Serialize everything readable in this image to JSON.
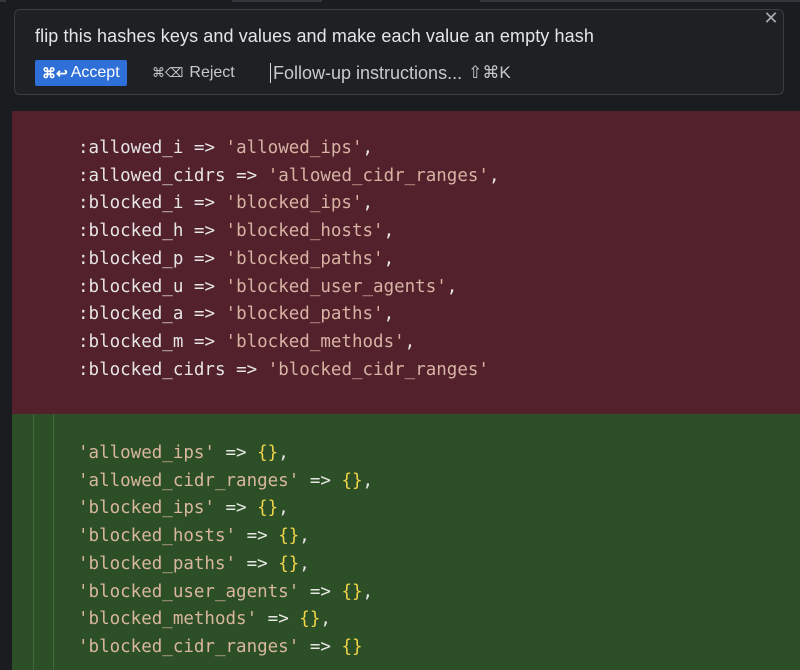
{
  "prompt": {
    "text": "flip this hashes keys and values and make each value an empty hash",
    "close_glyph": "✕"
  },
  "actions": {
    "accept": {
      "shortcut": "⌘↩",
      "label": "Accept",
      "color": "#2e6fd8"
    },
    "reject": {
      "shortcut": "⌘⌫",
      "label": "Reject"
    },
    "followup": {
      "placeholder": "Follow-up instructions...",
      "shortcut": "⇧⌘K"
    }
  },
  "diff": {
    "deleted_color": "#52212b",
    "added_color": "#2c4f27",
    "deleted_lines": [
      {
        "key": ":allowed_i",
        "arrow": "=>",
        "value": "'allowed_ips'",
        "trail": ","
      },
      {
        "key": ":allowed_cidrs",
        "arrow": "=>",
        "value": "'allowed_cidr_ranges'",
        "trail": ","
      },
      {
        "key": ":blocked_i",
        "arrow": "=>",
        "value": "'blocked_ips'",
        "trail": ","
      },
      {
        "key": ":blocked_h",
        "arrow": "=>",
        "value": "'blocked_hosts'",
        "trail": ","
      },
      {
        "key": ":blocked_p",
        "arrow": "=>",
        "value": "'blocked_paths'",
        "trail": ","
      },
      {
        "key": ":blocked_u",
        "arrow": "=>",
        "value": "'blocked_user_agents'",
        "trail": ","
      },
      {
        "key": ":blocked_a",
        "arrow": "=>",
        "value": "'blocked_paths'",
        "trail": ","
      },
      {
        "key": ":blocked_m",
        "arrow": "=>",
        "value": "'blocked_methods'",
        "trail": ","
      },
      {
        "key": ":blocked_cidrs",
        "arrow": "=>",
        "value": "'blocked_cidr_ranges'",
        "trail": ""
      }
    ],
    "added_lines": [
      {
        "key": "'allowed_ips'",
        "arrow": "=>",
        "value": "{}",
        "trail": ","
      },
      {
        "key": "'allowed_cidr_ranges'",
        "arrow": "=>",
        "value": "{}",
        "trail": ","
      },
      {
        "key": "'blocked_ips'",
        "arrow": "=>",
        "value": "{}",
        "trail": ","
      },
      {
        "key": "'blocked_hosts'",
        "arrow": "=>",
        "value": "{}",
        "trail": ","
      },
      {
        "key": "'blocked_paths'",
        "arrow": "=>",
        "value": "{}",
        "trail": ","
      },
      {
        "key": "'blocked_user_agents'",
        "arrow": "=>",
        "value": "{}",
        "trail": ","
      },
      {
        "key": "'blocked_methods'",
        "arrow": "=>",
        "value": "{}",
        "trail": ","
      },
      {
        "key": "'blocked_cidr_ranges'",
        "arrow": "=>",
        "value": "{}",
        "trail": ""
      }
    ]
  }
}
